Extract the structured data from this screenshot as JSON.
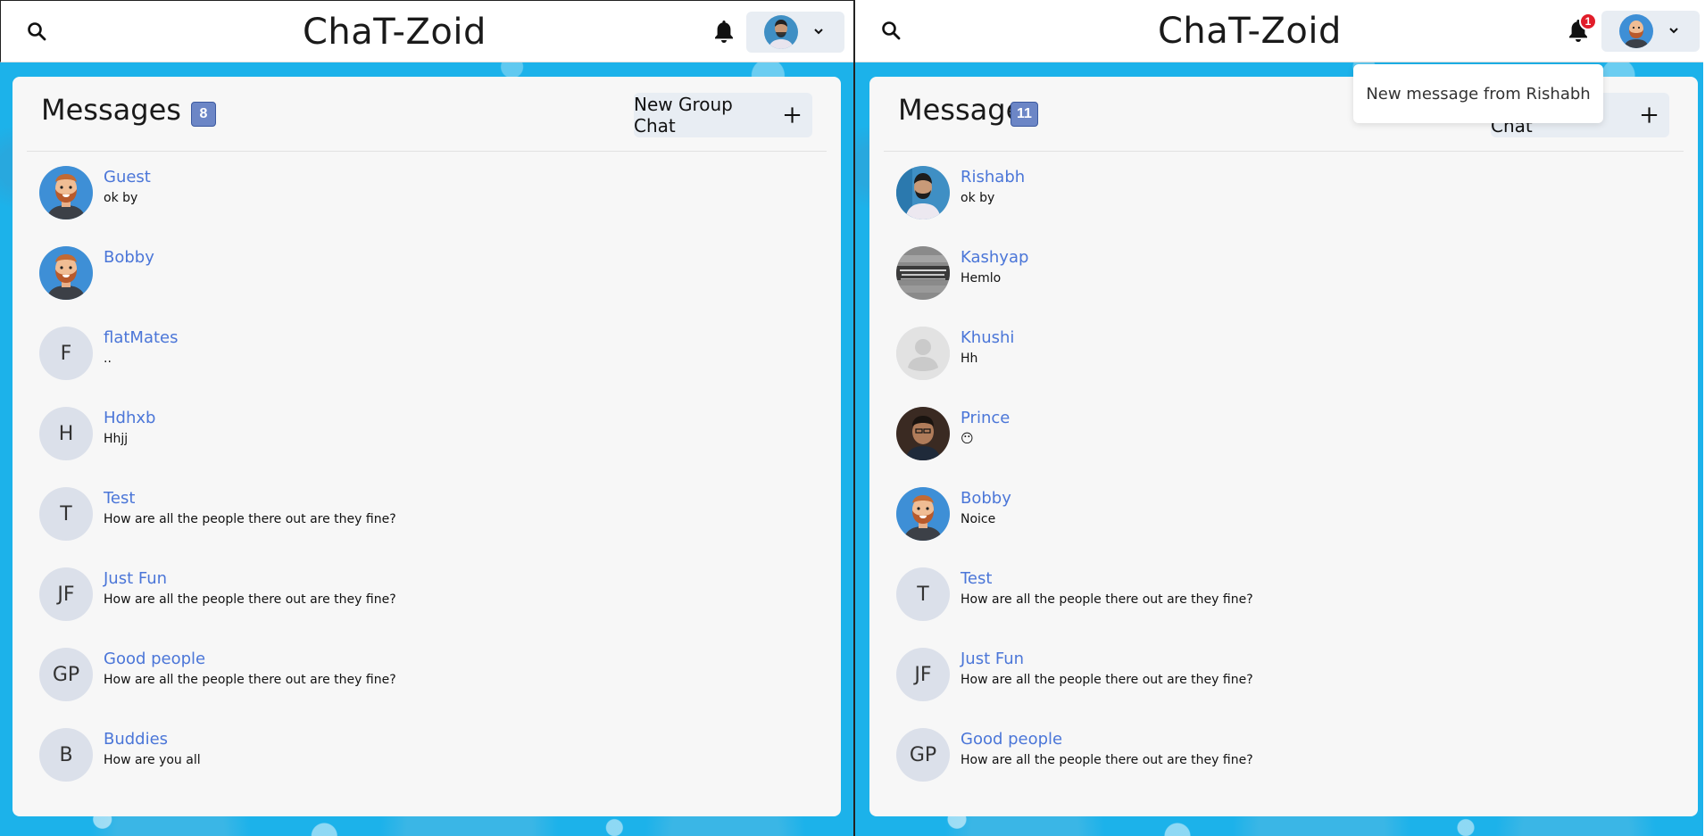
{
  "app": {
    "title": "ChaT-Zoid"
  },
  "left": {
    "messages_title": "Messages",
    "messages_count": "8",
    "new_group_label": "New Group Chat",
    "chats": [
      {
        "initials": "",
        "avatar": "cartoon",
        "name": "Guest",
        "preview": "ok by"
      },
      {
        "initials": "",
        "avatar": "cartoon",
        "name": "Bobby",
        "preview": ""
      },
      {
        "initials": "F",
        "avatar": "initials",
        "name": "flatMates",
        "preview": ".."
      },
      {
        "initials": "H",
        "avatar": "initials",
        "name": "Hdhxb",
        "preview": "Hhjj"
      },
      {
        "initials": "T",
        "avatar": "initials",
        "name": "Test",
        "preview": "How are all the people there out are they fine?"
      },
      {
        "initials": "JF",
        "avatar": "initials",
        "name": "Just Fun",
        "preview": "How are all the people there out are they fine?"
      },
      {
        "initials": "GP",
        "avatar": "initials",
        "name": "Good people",
        "preview": "How are all the people there out are they fine?"
      },
      {
        "initials": "B",
        "avatar": "initials",
        "name": "Buddies",
        "preview": "How are you all"
      }
    ]
  },
  "right": {
    "messages_title": "Messages",
    "messages_count": "11",
    "new_group_label": "New Group Chat",
    "notification_count": "1",
    "notification_text": "New message from Rishabh",
    "chats": [
      {
        "initials": "",
        "avatar": "photo-blue",
        "name": "Rishabh",
        "preview": "ok by"
      },
      {
        "initials": "",
        "avatar": "photo-gray",
        "name": "Kashyap",
        "preview": "Hemlo"
      },
      {
        "initials": "",
        "avatar": "default-user",
        "name": "Khushi",
        "preview": "Hh"
      },
      {
        "initials": "",
        "avatar": "photo-dark",
        "name": "Prince",
        "preview": "😶"
      },
      {
        "initials": "",
        "avatar": "cartoon",
        "name": "Bobby",
        "preview": "Noice"
      },
      {
        "initials": "T",
        "avatar": "initials",
        "name": "Test",
        "preview": "How are all the people there out are they fine?"
      },
      {
        "initials": "JF",
        "avatar": "initials",
        "name": "Just Fun",
        "preview": "How are all the people there out are they fine?"
      },
      {
        "initials": "GP",
        "avatar": "initials",
        "name": "Good people",
        "preview": "How are all the people there out are they fine?"
      }
    ]
  },
  "colors": {
    "accent": "#4b76d8",
    "badge": "#6c86c6",
    "notification_badge": "#e11d2a",
    "background": "#1cb2ea"
  }
}
